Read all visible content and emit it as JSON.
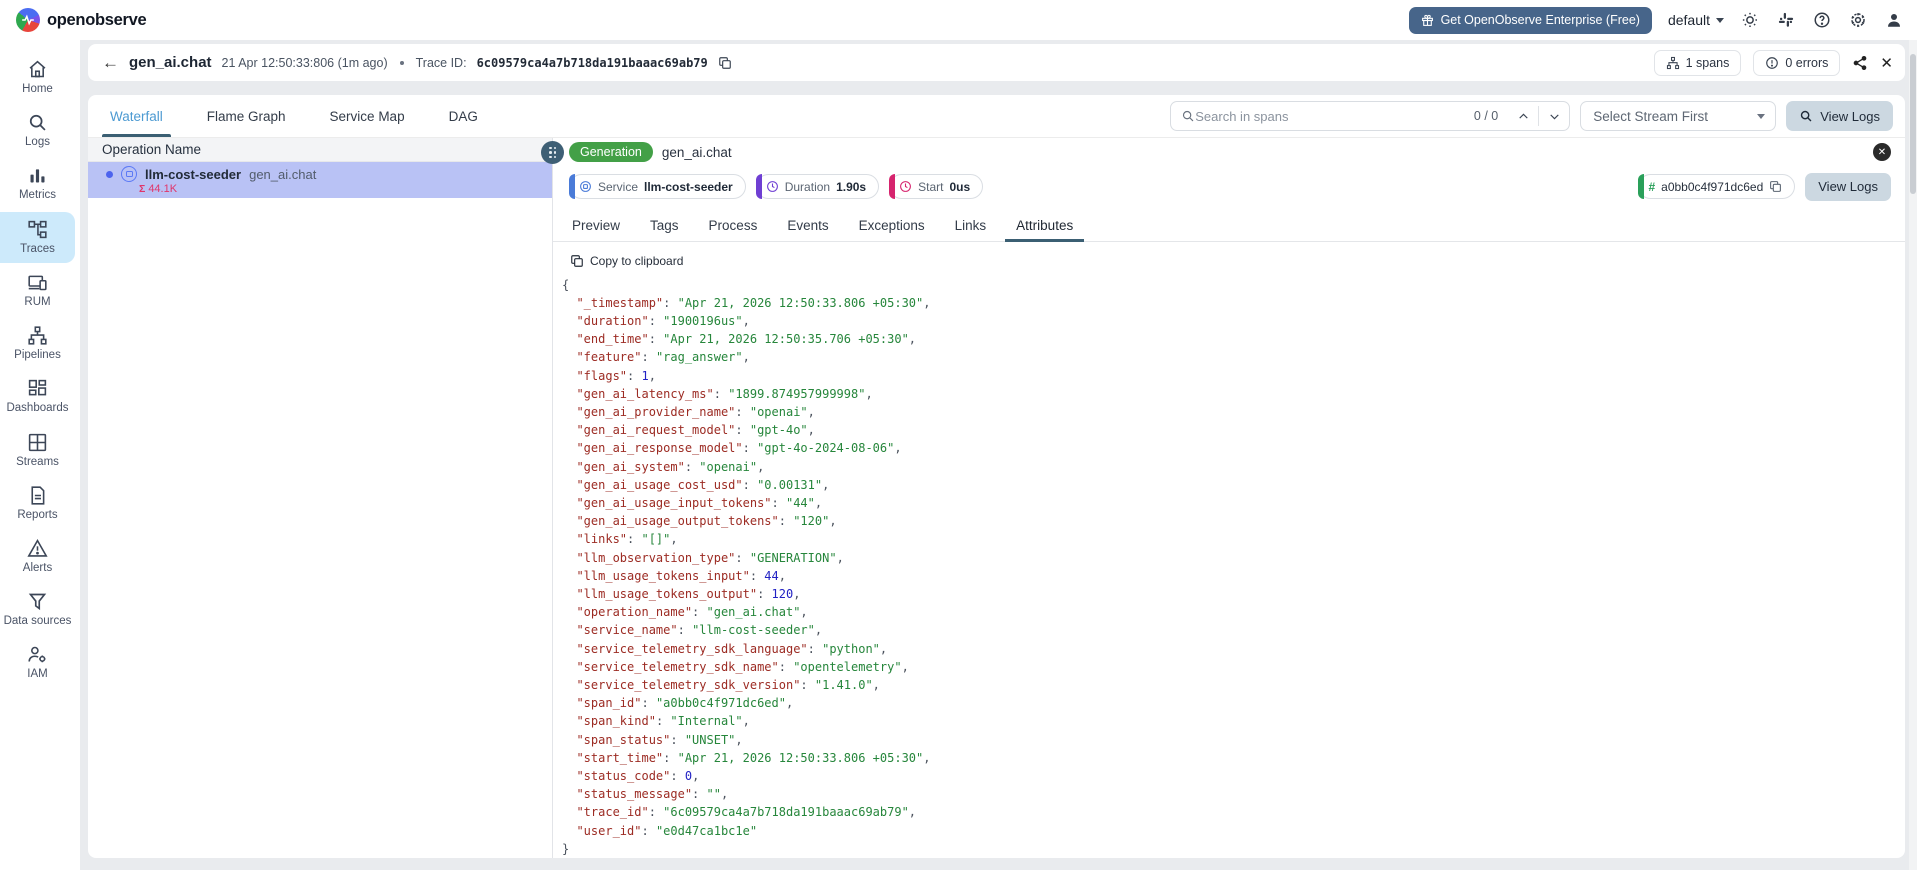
{
  "app": {
    "brand": "openobserve",
    "enterprise_button": "Get OpenObserve Enterprise (Free)",
    "org_selector": "default"
  },
  "sidebar": {
    "items": [
      {
        "label": "Home"
      },
      {
        "label": "Logs"
      },
      {
        "label": "Metrics"
      },
      {
        "label": "Traces"
      },
      {
        "label": "RUM"
      },
      {
        "label": "Pipelines"
      },
      {
        "label": "Dashboards"
      },
      {
        "label": "Streams"
      },
      {
        "label": "Reports"
      },
      {
        "label": "Alerts"
      },
      {
        "label": "Data sources"
      },
      {
        "label": "IAM"
      }
    ],
    "active": "Traces"
  },
  "trace_header": {
    "title": "gen_ai.chat",
    "timestamp": "21 Apr 12:50:33:806 (1m ago)",
    "trace_id_label": "Trace ID:",
    "trace_id": "6c09579ca4a7b718da191baaac69ab79",
    "spans_badge": "1 spans",
    "errors_badge": "0 errors"
  },
  "view_tabs": [
    "Waterfall",
    "Flame Graph",
    "Service Map",
    "DAG"
  ],
  "active_view_tab": "Waterfall",
  "span_search": {
    "placeholder": "Search in spans",
    "counter": "0 / 0"
  },
  "stream_select": {
    "value": "Select Stream First"
  },
  "toolbar_view_logs": "View Logs",
  "waterfall": {
    "column_header": "Operation Name",
    "spans": [
      {
        "service": "llm-cost-seeder",
        "operation": "gen_ai.chat",
        "events_count": "44.1K",
        "selected": true
      }
    ]
  },
  "span_detail": {
    "type_badge": "Generation",
    "operation": "gen_ai.chat",
    "service_label": "Service",
    "service_value": "llm-cost-seeder",
    "duration_label": "Duration",
    "duration_value": "1.90s",
    "start_label": "Start",
    "start_value": "0us",
    "span_id": "a0bb0c4f971dc6ed",
    "view_logs_button": "View Logs",
    "tabs": [
      "Preview",
      "Tags",
      "Process",
      "Events",
      "Exceptions",
      "Links",
      "Attributes"
    ],
    "active_tab": "Attributes",
    "copy_button": "Copy to clipboard",
    "attributes": [
      {
        "key": "_timestamp",
        "value": "Apr 21, 2026 12:50:33.806 +05:30",
        "type": "string"
      },
      {
        "key": "duration",
        "value": "1900196us",
        "type": "string"
      },
      {
        "key": "end_time",
        "value": "Apr 21, 2026 12:50:35.706 +05:30",
        "type": "string"
      },
      {
        "key": "feature",
        "value": "rag_answer",
        "type": "string"
      },
      {
        "key": "flags",
        "value": "1",
        "type": "number"
      },
      {
        "key": "gen_ai_latency_ms",
        "value": "1899.874957999998",
        "type": "string"
      },
      {
        "key": "gen_ai_provider_name",
        "value": "openai",
        "type": "string"
      },
      {
        "key": "gen_ai_request_model",
        "value": "gpt-4o",
        "type": "string"
      },
      {
        "key": "gen_ai_response_model",
        "value": "gpt-4o-2024-08-06",
        "type": "string"
      },
      {
        "key": "gen_ai_system",
        "value": "openai",
        "type": "string"
      },
      {
        "key": "gen_ai_usage_cost_usd",
        "value": "0.00131",
        "type": "string"
      },
      {
        "key": "gen_ai_usage_input_tokens",
        "value": "44",
        "type": "string"
      },
      {
        "key": "gen_ai_usage_output_tokens",
        "value": "120",
        "type": "string"
      },
      {
        "key": "links",
        "value": "[]",
        "type": "string"
      },
      {
        "key": "llm_observation_type",
        "value": "GENERATION",
        "type": "string"
      },
      {
        "key": "llm_usage_tokens_input",
        "value": "44",
        "type": "number"
      },
      {
        "key": "llm_usage_tokens_output",
        "value": "120",
        "type": "number"
      },
      {
        "key": "operation_name",
        "value": "gen_ai.chat",
        "type": "string"
      },
      {
        "key": "service_name",
        "value": "llm-cost-seeder",
        "type": "string"
      },
      {
        "key": "service_telemetry_sdk_language",
        "value": "python",
        "type": "string"
      },
      {
        "key": "service_telemetry_sdk_name",
        "value": "opentelemetry",
        "type": "string"
      },
      {
        "key": "service_telemetry_sdk_version",
        "value": "1.41.0",
        "type": "string"
      },
      {
        "key": "span_id",
        "value": "a0bb0c4f971dc6ed",
        "type": "string"
      },
      {
        "key": "span_kind",
        "value": "Internal",
        "type": "string"
      },
      {
        "key": "span_status",
        "value": "UNSET",
        "type": "string"
      },
      {
        "key": "start_time",
        "value": "Apr 21, 2026 12:50:33.806 +05:30",
        "type": "string"
      },
      {
        "key": "status_code",
        "value": "0",
        "type": "number"
      },
      {
        "key": "status_message",
        "value": "",
        "type": "string"
      },
      {
        "key": "trace_id",
        "value": "6c09579ca4a7b718da191baaac69ab79",
        "type": "string"
      },
      {
        "key": "user_id",
        "value": "e0d47ca1bc1e",
        "type": "string"
      }
    ]
  },
  "colors": {
    "accent_blue": "#4c9ad2",
    "tab_underline": "#3b5f73",
    "generation_green": "#43a047",
    "selected_row": "#b9c2f5",
    "service_accent": "#4a7bd8",
    "duration_accent": "#6f3fd3",
    "start_accent": "#d6246e",
    "spanid_accent": "#2aa05a",
    "events_count_red": "#e0356b",
    "enterprise_button_bg": "#47658a",
    "sidebar_active_bg": "#cdeafb",
    "json_key": "#9c2b23",
    "json_string": "#26863b",
    "json_number": "#2222c4"
  }
}
